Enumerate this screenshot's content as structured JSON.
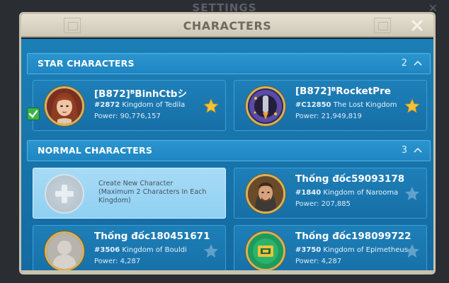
{
  "background": {
    "title": "SETTINGS"
  },
  "dialog": {
    "title": "CHARACTERS"
  },
  "sections": {
    "star": {
      "title": "STAR CHARACTERS",
      "count": "2"
    },
    "normal": {
      "title": "NORMAL CHARACTERS",
      "count": "3"
    }
  },
  "star_characters": [
    {
      "name": "[B872]ᴮBinhCtbシ",
      "kingdom_id": "#2872",
      "kingdom_name": "Kingdom of Tedila",
      "power": "Power: 90,776,157",
      "starred": true,
      "selected": true
    },
    {
      "name": "[B872]ᴮRocketPre",
      "kingdom_id": "#C12850",
      "kingdom_name": "The Lost Kingdom",
      "power": "Power: 21,949,819",
      "starred": true,
      "selected": false
    }
  ],
  "create": {
    "label": "Create New Character",
    "sublabel": "(Maximum 2 Characters In Each Kingdom)"
  },
  "normal_characters": [
    {
      "name": "Thống đốc59093178",
      "kingdom_id": "#1840",
      "kingdom_name": "Kingdom of Narooma",
      "power": "Power: 207,885",
      "starred": false
    },
    {
      "name": "Thống đốc180451671",
      "kingdom_id": "#3506",
      "kingdom_name": "Kingdom of Bouldi",
      "power": "Power: 4,287",
      "starred": false
    },
    {
      "name": "Thống đốc198099722",
      "kingdom_id": "#3750",
      "kingdom_name": "Kingdom of Epimetheus",
      "power": "Power: 4,287",
      "starred": false
    }
  ],
  "colors": {
    "star_gold": "#f2c23a",
    "star_empty": "#6fa9cf",
    "accent_blue": "#1b7fb6",
    "check_green": "#39b34a"
  }
}
